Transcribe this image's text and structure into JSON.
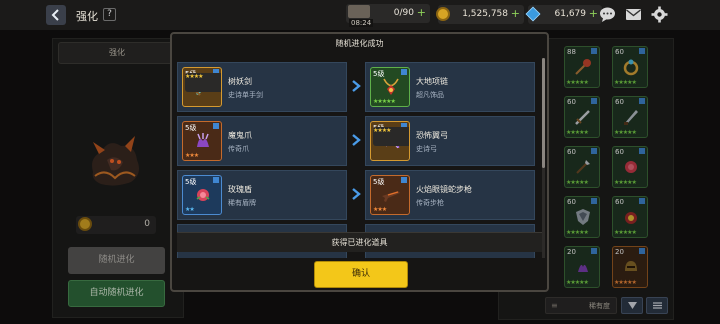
{
  "header": {
    "title": "强化",
    "help_label": "?",
    "stamina": "0/90",
    "timer": "08:24",
    "gold": "1,525,758",
    "gems": "61,679",
    "plus": "+"
  },
  "left": {
    "tab_label": "强化",
    "cost_value": "0",
    "random_button": "随机进化",
    "auto_button": "自动随机进化"
  },
  "inventory": {
    "search_label": "稀有度",
    "cards": [
      {
        "level": "88",
        "rarity": "green",
        "stars": "★★★★★"
      },
      {
        "level": "60",
        "rarity": "green",
        "stars": "★★★★★"
      },
      {
        "level": "60",
        "rarity": "green",
        "stars": "★★★★★"
      },
      {
        "level": "60",
        "rarity": "green",
        "stars": "★★★★★"
      },
      {
        "level": "60",
        "rarity": "green",
        "stars": "★★★★★"
      },
      {
        "level": "60",
        "rarity": "green",
        "stars": "★★★★★"
      },
      {
        "level": "60",
        "rarity": "green",
        "stars": "★★★★★"
      },
      {
        "level": "60",
        "rarity": "green",
        "stars": "★★★★★"
      },
      {
        "level": "20",
        "rarity": "green",
        "stars": "★★★★★"
      },
      {
        "level": "20",
        "rarity": "orange",
        "stars": "★★★★★"
      }
    ]
  },
  "modal": {
    "title": "随机进化成功",
    "footer": "获得已进化道具",
    "confirm": "确认",
    "rows": [
      {
        "from": {
          "level": "5级",
          "name": "树妖剑",
          "type": "史诗单手剑",
          "rarity": "gold",
          "stars": "★★★★"
        },
        "to": {
          "level": "5级",
          "name": "大地项链",
          "type": "超凡饰品",
          "rarity": "green",
          "stars": "★★★★★"
        }
      },
      {
        "from": {
          "level": "5级",
          "name": "魔鬼爪",
          "type": "传奇爪",
          "rarity": "orange",
          "stars": "★★★"
        },
        "to": {
          "level": "5级",
          "name": "恐怖翼弓",
          "type": "史诗弓",
          "rarity": "gold",
          "stars": "★★★★"
        }
      },
      {
        "from": {
          "level": "5级",
          "name": "玫瑰盾",
          "type": "稀有盾牌",
          "rarity": "blue",
          "stars": "★★"
        },
        "to": {
          "level": "5级",
          "name": "火焰眼镜蛇步枪",
          "type": "传奇步枪",
          "rarity": "orange",
          "stars": "★★★"
        }
      }
    ]
  },
  "colors": {
    "confirm_button": "#f3c719",
    "auto_button": "#2f6b3d",
    "row_background": "#263445"
  },
  "icons": [
    "back-arrow-icon",
    "help-icon",
    "stamina-icon",
    "coin-icon",
    "gem-icon",
    "chat-icon",
    "mail-icon",
    "gear-icon",
    "right-arrow-icon",
    "filter-icon",
    "sort-icon"
  ]
}
